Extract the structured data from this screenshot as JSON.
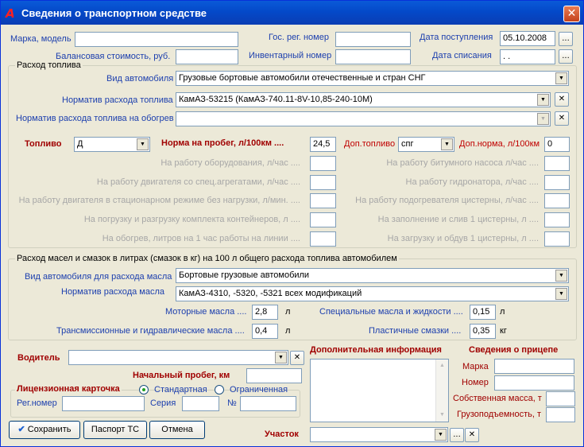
{
  "window": {
    "title": "Сведения о транспортном средстве",
    "close": "✕"
  },
  "top": {
    "brand_label": "Марка, модель",
    "brand_value": "",
    "reg_label": "Гос. рег. номер",
    "reg_value": "",
    "date_in_label": "Дата поступления",
    "date_in_value": "05.10.2008",
    "balance_label": "Балансовая стоимость, руб.",
    "balance_value": "",
    "inv_label": "Инвентарный номер",
    "inv_value": "",
    "date_off_label": "Дата списания",
    "date_off_value": ". .",
    "ellipsis": "..."
  },
  "fuel": {
    "group_title": "Расход топлива",
    "vehicle_type_label": "Вид автомобиля",
    "vehicle_type_value": "Грузовые бортовые автомобили отечественные и стран СНГ",
    "norm_label": "Норматив расхода топлива",
    "norm_value": "КамАЗ-53215 (КамАЗ-740.11-8V-10,85-240-10M)",
    "heating_label": "Норматив расхода топлива на обогрев",
    "heating_value": "",
    "fuel_label": "Топливо",
    "fuel_value": "Д",
    "run_norm_label": "Норма на пробег, л/100км ....",
    "run_norm_value": "24,5",
    "add_fuel_label": "Доп.топливо",
    "add_fuel_value": "спг",
    "add_norm_label": "Доп.норма, л/100км",
    "add_norm_value": "0",
    "left_rows": [
      "На работу оборудования, л/час ....",
      "На работу двигателя со спец.агрегатами, л/час ....",
      "На работу двигателя в стационарном режиме без нагрузки, л/мин. ....",
      "На погрузку и разгрузку комплекта контейнеров, л ....",
      "На обогрев, литров на 1 час работы на линии ...."
    ],
    "right_rows": [
      "На работу битумного насоса л/час ....",
      "На работу гидронатора, л/час ....",
      "На работу подогревателя цистерны, л/час ....",
      "На заполнение и слив 1 цистерны, л ....",
      "На загрузку и обдув 1 цистерны, л ...."
    ]
  },
  "oil": {
    "group_title": "Расход масел и смазок в литрах (смазок в кг) на 100 л общего расхода топлива автомобилем",
    "vehicle_type_label": "Вид автомобиля для расхода масла",
    "vehicle_type_value": "Бортовые грузовые автомобили",
    "norm_label": "Норматив расхода масла",
    "norm_value": "КамАЗ-4310, -5320, -5321 всех модификаций",
    "motor_label": "Моторные масла ....",
    "motor_value": "2,8",
    "special_label": "Специальные масла и жидкости ....",
    "special_value": "0,15",
    "trans_label": "Трансмиссионные и гидравлические масла ....",
    "trans_value": "0,4",
    "plastic_label": "Пластичные смазки ....",
    "plastic_value": "0,35",
    "unit_l": "л",
    "unit_kg": "кг"
  },
  "driver": {
    "label": "Водитель",
    "value": "",
    "start_run_label": "Начальный пробег, км",
    "start_run_value": ""
  },
  "license": {
    "group_title": "Лицензионная карточка",
    "opt_standard": "Стандартная",
    "opt_limited": "Ограниченная",
    "reg_label": "Рег.номер",
    "series_label": "Серия",
    "num_label": "№"
  },
  "extra": {
    "label": "Дополнительная информация"
  },
  "trailer": {
    "title": "Сведения о прицепе",
    "brand_label": "Марка",
    "number_label": "Номер",
    "mass_label": "Собственная масса, т",
    "capacity_label": "Грузоподъемность, т"
  },
  "section": {
    "label": "Участок"
  },
  "buttons": {
    "save": "Сохранить",
    "passport": "Паспорт ТС",
    "cancel": "Отмена"
  },
  "icons": {
    "close_small": "✕",
    "arrow": "▼",
    "check": "✔"
  }
}
